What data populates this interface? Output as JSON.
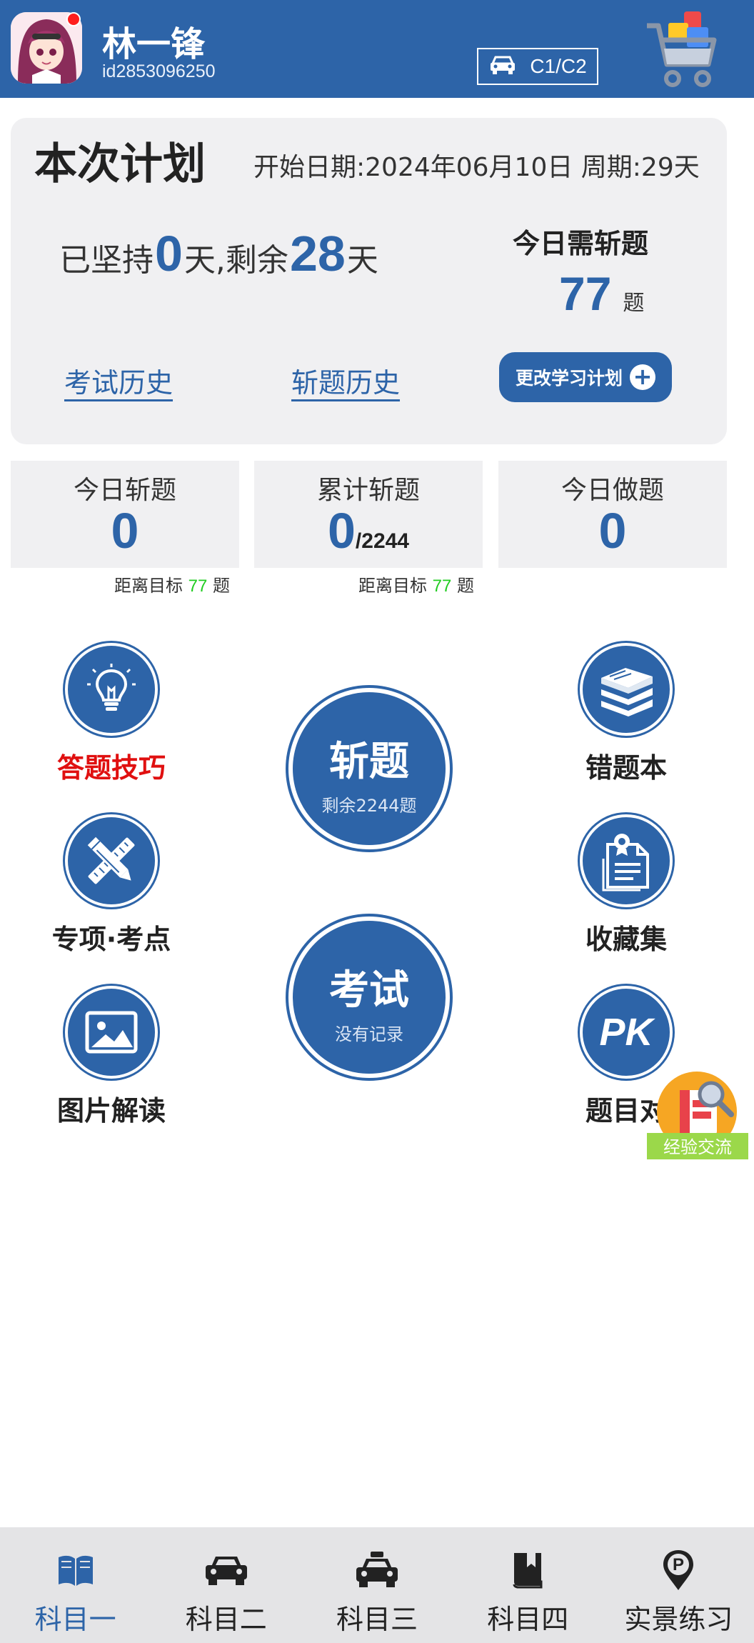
{
  "header": {
    "user_name": "林一锋",
    "user_id": "id2853096250",
    "license_type": "C1/C2",
    "icons": [
      "avatar",
      "car-icon",
      "shopping-cart-icon"
    ]
  },
  "plan": {
    "title": "本次计划",
    "start_date_text": "开始日期:2024年06月10日 周期:29天",
    "persist_prefix": "已坚持",
    "persist_days": "0",
    "persist_mid": "天,剩余",
    "remaining_days": "28",
    "persist_suffix": "天",
    "need_label": "今日需斩题",
    "need_value": "77",
    "need_unit": "题",
    "exam_history": "考试历史",
    "slay_history": "斩题历史",
    "change_plan": "更改学习计划"
  },
  "stats": [
    {
      "label": "今日斩题",
      "value": "0"
    },
    {
      "label": "累计斩题",
      "value": "0",
      "total": "/2244"
    },
    {
      "label": "今日做题",
      "value": "0"
    }
  ],
  "goals": [
    {
      "prefix": "距离目标",
      "value": "77",
      "unit": "题"
    },
    {
      "prefix": "距离目标",
      "value": "77",
      "unit": "题"
    }
  ],
  "features": {
    "tips": "答题技巧",
    "topic": "专项·考点",
    "image": "图片解读",
    "wrong": "错题本",
    "fav": "收藏集",
    "pk": "题目对"
  },
  "main_actions": {
    "slay_title": "斩题",
    "slay_sub": "剩余2244题",
    "exam_title": "考试",
    "exam_sub": "没有记录"
  },
  "float": {
    "exchange": "经验交流"
  },
  "nav": [
    {
      "label": "科目一",
      "icon": "book-icon",
      "active": true
    },
    {
      "label": "科目二",
      "icon": "car-icon",
      "active": false
    },
    {
      "label": "科目三",
      "icon": "taxi-icon",
      "active": false
    },
    {
      "label": "科目四",
      "icon": "bookmark-book-icon",
      "active": false
    },
    {
      "label": "实景练习",
      "icon": "location-pin-icon",
      "active": false
    }
  ],
  "colors": {
    "primary": "#2d64a8",
    "accent_red": "#e01010",
    "goal_green": "#22cc22"
  }
}
